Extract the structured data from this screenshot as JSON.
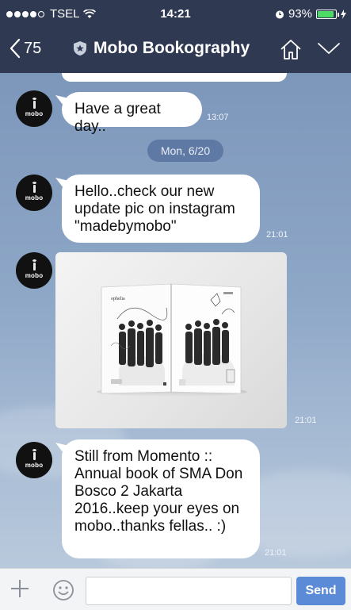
{
  "status_bar": {
    "carrier": "TSEL",
    "time": "14:21",
    "battery": "93%",
    "battery_level": 0.93
  },
  "nav": {
    "back_count": "75",
    "title": "Mobo Bookography",
    "icons": [
      "chevron-left-icon",
      "shield-icon",
      "home-icon",
      "chevron-down-icon"
    ]
  },
  "avatar": {
    "label": "mobo"
  },
  "messages": [
    {
      "text": "Have a great day..",
      "time": "13:07"
    },
    {
      "text": "Hello..check our new update pic on instagram \"madebymobo\"",
      "time": "21:01"
    },
    {
      "type": "image",
      "time": "21:01"
    },
    {
      "text": "Still from Momento :: Annual book of SMA Don Bosco 2 Jakarta 2016..keep your eyes on mobo..thanks fellas.. :)",
      "time": "21:01"
    }
  ],
  "date_divider": "Mon, 6/20",
  "input_bar": {
    "placeholder": "",
    "send_label": "Send",
    "icons": [
      "plus-icon",
      "emoji-icon"
    ]
  },
  "colors": {
    "header": "#2f3a52",
    "bubble": "#ffffff",
    "send_button": "#5b8bd6",
    "date_chip": "#5f79a5"
  }
}
